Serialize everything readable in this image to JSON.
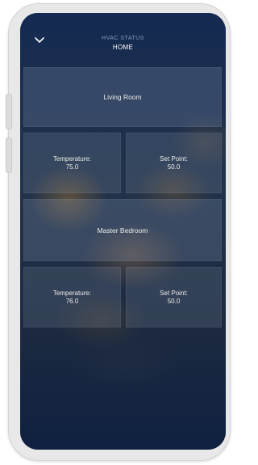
{
  "header": {
    "subtitle": "HVAC STATUS",
    "title": "HOME"
  },
  "rooms": [
    {
      "name": "Living Room",
      "temperature_label": "Temperature:",
      "temperature_value": "75.0",
      "setpoint_label": "Set Point:",
      "setpoint_value": "50.0"
    },
    {
      "name": "Master Bedroom",
      "temperature_label": "Temperature:",
      "temperature_value": "76.0",
      "setpoint_label": "Set Point:",
      "setpoint_value": "50.0"
    }
  ],
  "icons": {
    "back": "chevron-down-icon"
  },
  "colors": {
    "screen_background": "#0f2344",
    "text": "#ecebe6",
    "subtitle": "#8a9bb8"
  }
}
